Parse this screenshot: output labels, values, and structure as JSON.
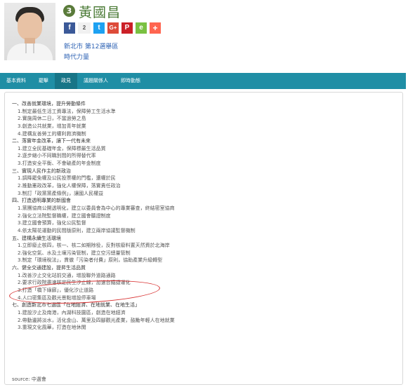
{
  "candidate": {
    "number": "3",
    "name": "黃國昌",
    "district": "新北市 第12選舉區",
    "party": "時代力量",
    "photo_icon": "candidate-portrait"
  },
  "share": {
    "facebook": "f",
    "count": "2",
    "twitter": "t",
    "googleplus": "G+",
    "pinterest": "P",
    "evernote": "e",
    "more": "+"
  },
  "tabs": [
    {
      "label": "基本資料"
    },
    {
      "label": "罷擊"
    },
    {
      "label": "政見"
    },
    {
      "label": "議題關係人"
    },
    {
      "label": "即時動態"
    }
  ],
  "policy": [
    {
      "t": "sec",
      "text": "一、改善就業環境，提升勞動條件"
    },
    {
      "t": "item",
      "text": "1.制定最低生活工資專法，保障勞工生活水準"
    },
    {
      "t": "item",
      "text": "2.實施周休二日，不當過勞之島"
    },
    {
      "t": "item",
      "text": "3.創造公共就業，增加青年就業"
    },
    {
      "t": "item",
      "text": "4.建構友善勞工的權利救濟機制"
    },
    {
      "t": "sec",
      "text": "二、落實年金改革，讓下一代有未來"
    },
    {
      "t": "item",
      "text": "1.建立全民基礎年金，保障標最生活品質"
    },
    {
      "t": "item",
      "text": "2.逐步縮小不同職別間的所得替代率"
    },
    {
      "t": "item",
      "text": "3.打造安全平衡、不會破產的年金制度"
    },
    {
      "t": "sec",
      "text": "三、實現人民作主的新政治"
    },
    {
      "t": "item",
      "text": "1.調降罷免權及公民投票權的門檻，還權於民"
    },
    {
      "t": "item",
      "text": "2.推動憲政改革，強化人權保障，落實責任政治"
    },
    {
      "t": "item",
      "text": "3.制訂「政黨黨產條例」，讓國人民權益"
    },
    {
      "t": "sec",
      "text": "四、打造透明專業的新國會"
    },
    {
      "t": "item",
      "text": "1.黨團協商公開透明化，建立以委員會為中心的專業審查，終結密室協商"
    },
    {
      "t": "item",
      "text": "2.強化立法院監督職權，建立國會聽證制度"
    },
    {
      "t": "item",
      "text": "3.建立國會預算，強化公民監督"
    },
    {
      "t": "item",
      "text": "4.依太陽花運動的民間版原則，建立兩岸協議監督機制"
    },
    {
      "t": "sec",
      "text": "五、建構永續生活環境"
    },
    {
      "t": "item",
      "text": "1.立即廢止核四，核一、核二如期除役，反對核廢料置天然資於北海岸"
    },
    {
      "t": "item",
      "text": "2.強化空氣、水及土壤污染管制，建立空污總量管制"
    },
    {
      "t": "item",
      "text": "3.制定「環境稅法」，貫徹「污染者付費」原則，協助產業升級轉型"
    },
    {
      "t": "sec",
      "text": "六、健全交通建設，提昇生活品質"
    },
    {
      "t": "item",
      "text": "1.改善汐止交化站前交通，增設聯外道路通路"
    },
    {
      "t": "item",
      "text": "2.要求行政院盡速核定民生汐止線，加速台鐵捷運化"
    },
    {
      "t": "item",
      "text": "3.打造「橋下綠廊」，優化汐止道路"
    },
    {
      "t": "item",
      "text": "4.人口密集區及觀光景點增設停車場"
    },
    {
      "t": "sec",
      "text": "七、創造新北市七選區「在地經濟、在地就業、在地生活」"
    },
    {
      "t": "item",
      "text": "1.建設汐止及南港，內湖科技園區，創造在地經濟"
    },
    {
      "t": "item",
      "text": "2.帶動邊將淡水，活化金山、萬里及四腳觀光產業，鼓勵年輕人在地就業"
    },
    {
      "t": "item",
      "text": "3.重現文化風華，打造在地休閒"
    }
  ],
  "source": "source: 中選會"
}
